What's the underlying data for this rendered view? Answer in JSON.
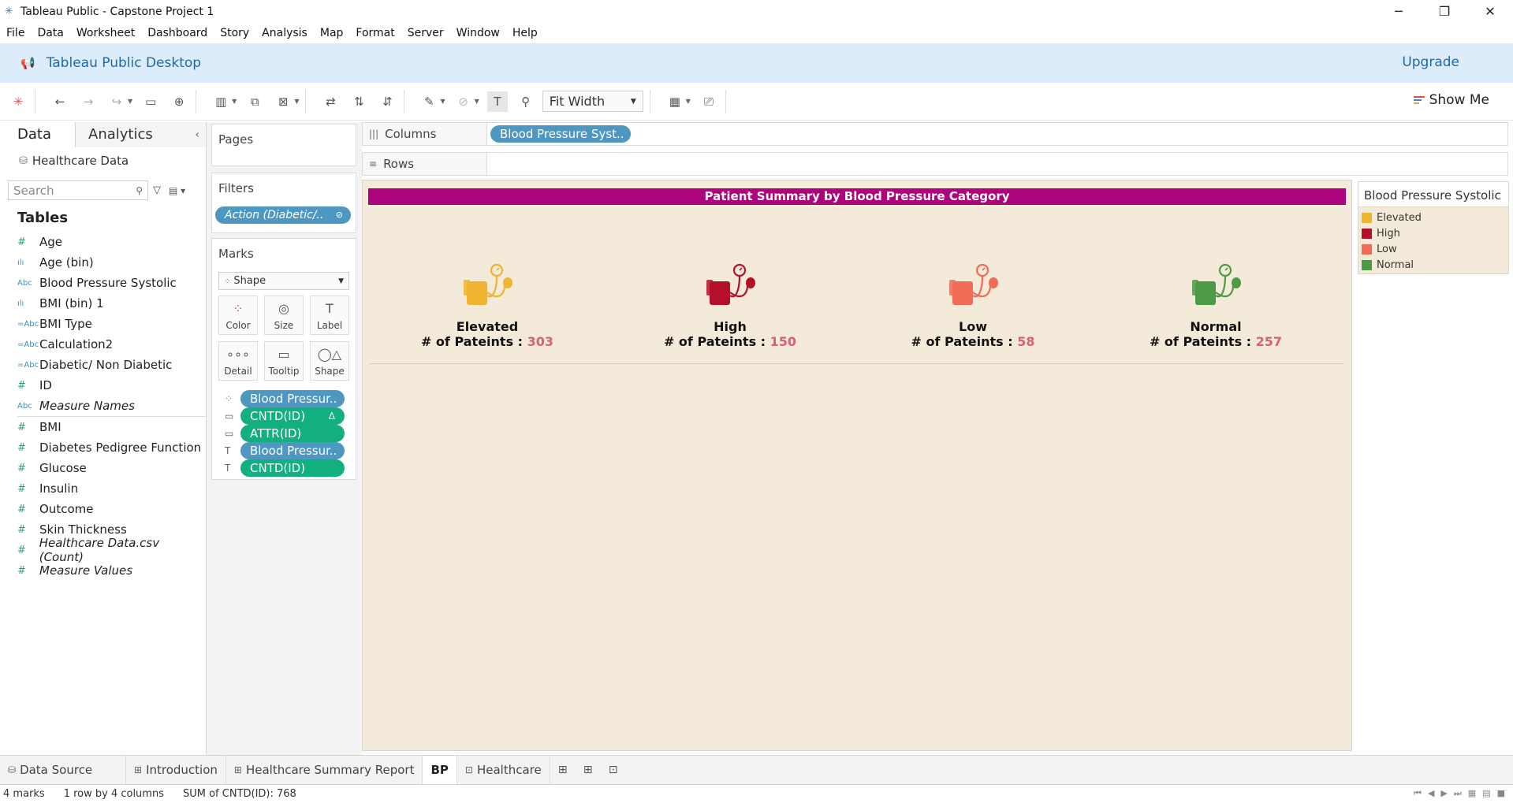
{
  "window": {
    "title": "Tableau Public - Capstone Project 1",
    "minimize": "─",
    "restore": "❐",
    "close": "✕"
  },
  "menu": [
    "File",
    "Data",
    "Worksheet",
    "Dashboard",
    "Story",
    "Analysis",
    "Map",
    "Format",
    "Server",
    "Window",
    "Help"
  ],
  "banner": {
    "title": "Tableau Public Desktop",
    "upgrade": "Upgrade"
  },
  "toolbar": {
    "fit": "Fit Width",
    "show_me": "Show Me"
  },
  "data_pane": {
    "tab_data": "Data",
    "tab_analytics": "Analytics",
    "datasource": "Healthcare Data",
    "search_placeholder": "Search",
    "tables_label": "Tables",
    "dimensions": [
      {
        "type": "#",
        "name": "Age",
        "italic": false
      },
      {
        "type": "ılı",
        "name": "Age (bin)",
        "italic": false
      },
      {
        "type": "Abc",
        "name": "Blood Pressure Systolic",
        "italic": false
      },
      {
        "type": "ılı",
        "name": "BMI (bin) 1",
        "italic": false
      },
      {
        "type": "=Abc",
        "name": "BMI Type",
        "italic": false
      },
      {
        "type": "=Abc",
        "name": "Calculation2",
        "italic": false
      },
      {
        "type": "=Abc",
        "name": "Diabetic/ Non Diabetic",
        "italic": false
      },
      {
        "type": "#",
        "name": "ID",
        "italic": false
      },
      {
        "type": "Abc",
        "name": "Measure Names",
        "italic": true
      }
    ],
    "measures": [
      {
        "type": "#",
        "name": "BMI",
        "italic": false
      },
      {
        "type": "#",
        "name": "Diabetes Pedigree Function",
        "italic": false
      },
      {
        "type": "#",
        "name": "Glucose",
        "italic": false
      },
      {
        "type": "#",
        "name": "Insulin",
        "italic": false
      },
      {
        "type": "#",
        "name": "Outcome",
        "italic": false
      },
      {
        "type": "#",
        "name": "Skin Thickness",
        "italic": false
      },
      {
        "type": "#",
        "name": "Healthcare Data.csv (Count)",
        "italic": true
      },
      {
        "type": "#",
        "name": "Measure Values",
        "italic": true
      }
    ]
  },
  "shelves": {
    "pages": "Pages",
    "filters": "Filters",
    "filter_pill": "Action (Diabetic/..",
    "marks": "Marks",
    "mark_type": "Shape",
    "mark_buttons": {
      "color": "Color",
      "size": "Size",
      "label": "Label",
      "detail": "Detail",
      "tooltip": "Tooltip",
      "shape": "Shape"
    },
    "mark_pills": [
      {
        "icon": "color-icon",
        "label": "Blood Pressur..",
        "color": "blue",
        "delta": ""
      },
      {
        "icon": "tooltip-icon",
        "label": "CNTD(ID)",
        "color": "green",
        "delta": "Δ"
      },
      {
        "icon": "tooltip-icon",
        "label": "ATTR(ID)",
        "color": "green",
        "delta": ""
      },
      {
        "icon": "label-icon",
        "label": "Blood Pressur..",
        "color": "blue",
        "delta": ""
      },
      {
        "icon": "label-icon",
        "label": "CNTD(ID)",
        "color": "green",
        "delta": ""
      }
    ],
    "columns_label": "Columns",
    "columns_pill": "Blood Pressure Syst..",
    "rows_label": "Rows"
  },
  "viz": {
    "title": "Patient Summary by Blood Pressure Category",
    "count_label": "# of Pateints :",
    "categories": [
      {
        "name": "Elevated",
        "count": "303",
        "color": "#efb52e"
      },
      {
        "name": "High",
        "count": "150",
        "color": "#b5102a"
      },
      {
        "name": "Low",
        "count": "58",
        "color": "#f06c57"
      },
      {
        "name": "Normal",
        "count": "257",
        "color": "#4d9a46"
      }
    ]
  },
  "legend": {
    "title": "Blood Pressure Systolic",
    "items": [
      {
        "label": "Elevated",
        "color": "#efb52e"
      },
      {
        "label": "High",
        "color": "#b5102a"
      },
      {
        "label": "Low",
        "color": "#f06c57"
      },
      {
        "label": "Normal",
        "color": "#4d9a46"
      }
    ]
  },
  "sheet_tabs": {
    "data_source": "Data Source",
    "tabs": [
      {
        "label": "Introduction",
        "active": false
      },
      {
        "label": "Healthcare Summary Report",
        "active": false
      },
      {
        "label": "BP",
        "active": true
      },
      {
        "label": "Healthcare",
        "active": false
      }
    ]
  },
  "status": {
    "marks": "4 marks",
    "dims": "1 row by 4 columns",
    "sum": "SUM of CNTD(ID): 768"
  }
}
